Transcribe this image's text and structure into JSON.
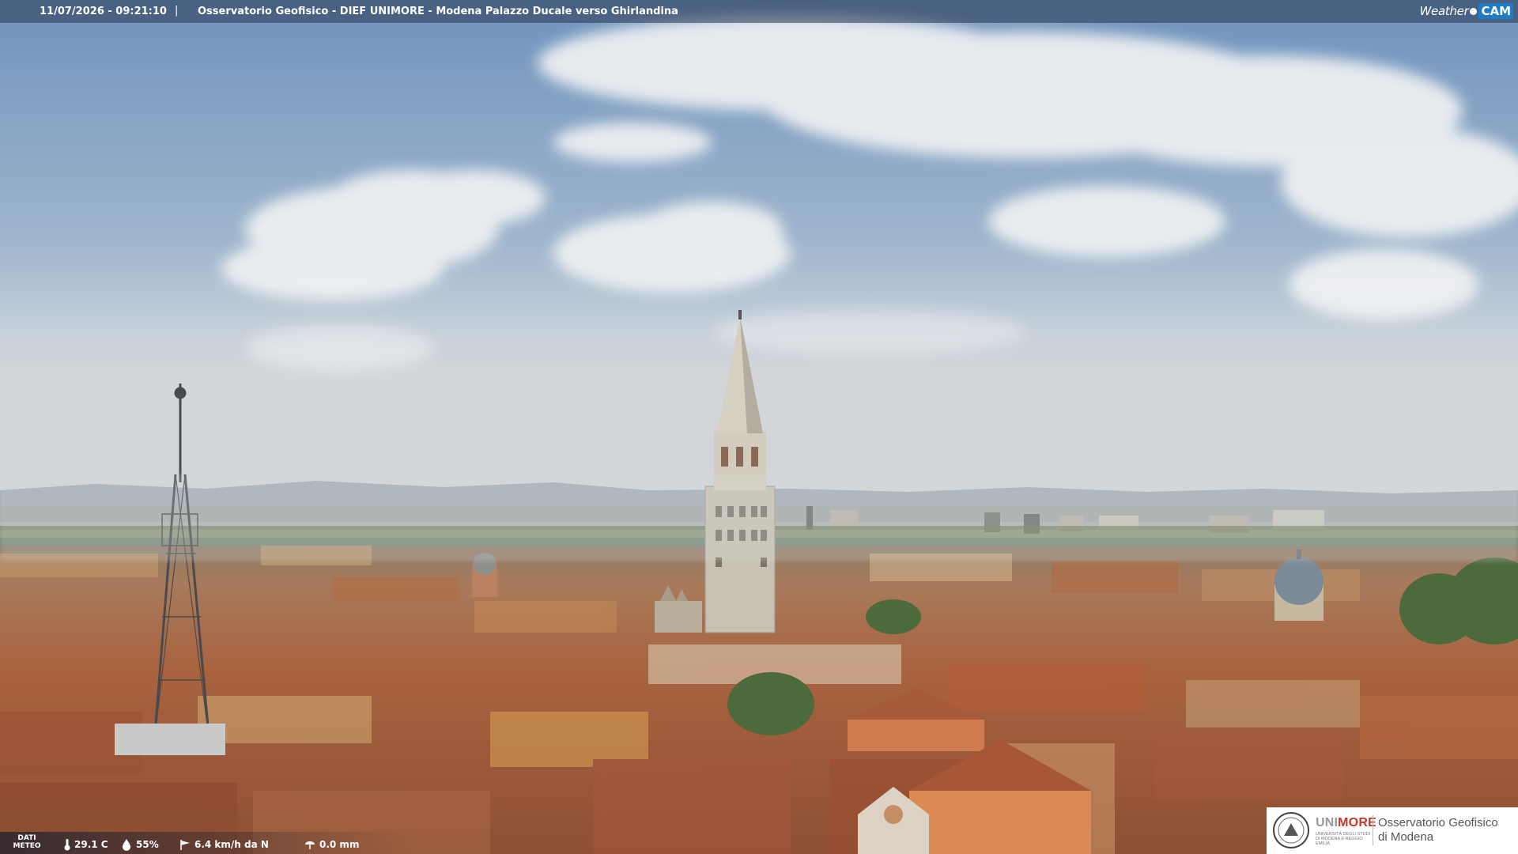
{
  "header": {
    "timestamp": "11/07/2026 - 09:21:10",
    "separator": "|",
    "title": "Osservatorio Geofisico - DIEF UNIMORE - Modena Palazzo Ducale verso Ghirlandina",
    "brand_weather": "Weather",
    "brand_cam": "CAM"
  },
  "meteo": {
    "label_line1": "DATI",
    "label_line2": "METEO",
    "temperature": "29.1 C",
    "humidity": "55%",
    "wind": "6.4 km/h da N",
    "rain": "0.0 mm"
  },
  "logo": {
    "uni_prefix": "UNI",
    "uni_suffix": "MORE",
    "uni_sub": "UNIVERSITÀ DEGLI STUDI DI MODENA E REGGIO EMILIA",
    "line1": "Osservatorio Geofisico",
    "line2": "di Modena"
  },
  "icons": {
    "temperature": "thermometer-icon",
    "humidity": "droplet-icon",
    "wind": "wind-vane-icon",
    "rain": "rain-gauge-icon"
  },
  "colors": {
    "sky_top": "#6f93bd",
    "sky_horizon": "#c9d3dc",
    "roofs": "#a8613f",
    "tower": "#c9c2b4",
    "brand_blue": "#1e7bc4",
    "unimore_red": "#c0392b"
  }
}
